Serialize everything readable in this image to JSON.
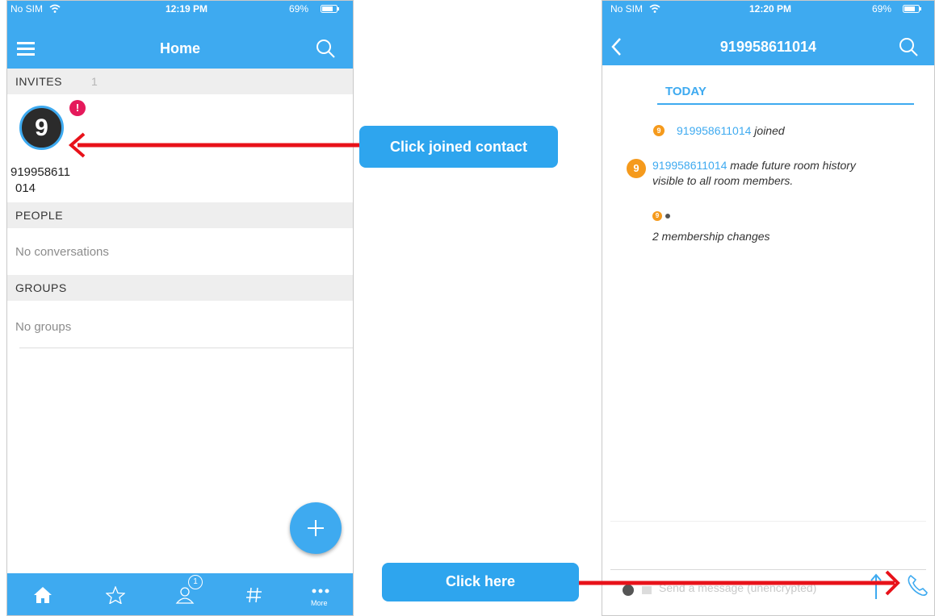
{
  "left_phone": {
    "status": {
      "carrier": "No SIM",
      "time": "12:19 PM",
      "battery": "69%"
    },
    "title": "Home",
    "invites": {
      "label": "INVITES",
      "count": "1"
    },
    "invite_contact": {
      "avatar_letter": "9",
      "badge": "!",
      "name_line1": "919958611",
      "name_line2": "014"
    },
    "people": {
      "label": "PEOPLE",
      "empty": "No conversations"
    },
    "groups": {
      "label": "GROUPS",
      "empty": "No groups"
    },
    "tabs": [
      {
        "icon": "home-icon"
      },
      {
        "icon": "star-icon"
      },
      {
        "icon": "person-icon",
        "badge": "1"
      },
      {
        "icon": "hashtag-icon"
      },
      {
        "icon": "more-icon",
        "label": "More"
      }
    ]
  },
  "right_phone": {
    "status": {
      "carrier": "No SIM",
      "time": "12:20 PM",
      "battery": "69%"
    },
    "title": "919958611014",
    "date_header": "TODAY",
    "events": [
      {
        "avatar": "9",
        "user": "919958611014",
        "text": "joined"
      },
      {
        "avatar": "9",
        "user": "919958611014",
        "text": "made future room history",
        "text2": "visible to all room members."
      },
      {
        "avatar": "9",
        "text": "2 membership changes"
      }
    ],
    "composer_placeholder": "Send a message (unencrypted)"
  },
  "callouts": {
    "joined": "Click joined contact",
    "here": "Click here"
  },
  "colors": {
    "accent": "#3eaaf0",
    "arrow": "#e8121a",
    "badge": "#e5195b",
    "avatar": "#f59a1c"
  }
}
